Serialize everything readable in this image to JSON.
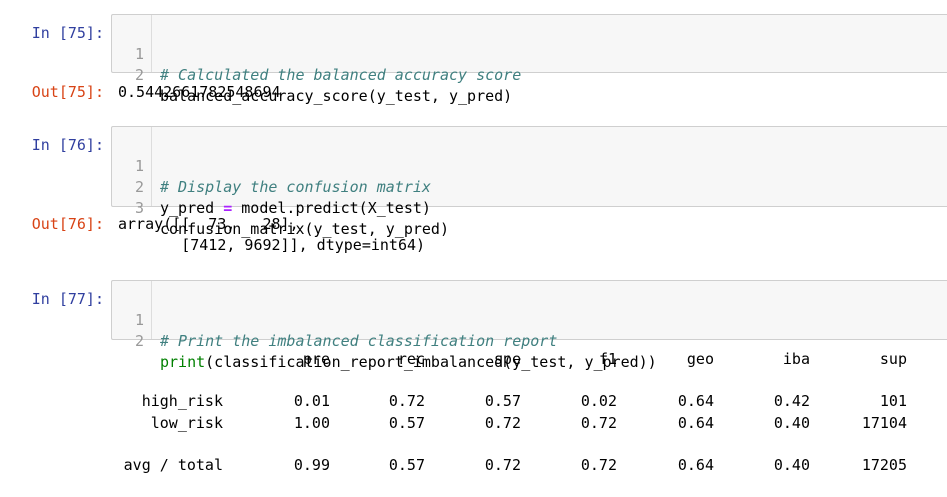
{
  "cells": [
    {
      "in_prompt": "In [75]:",
      "lines": [
        {
          "num": "1",
          "comment": "# Calculated the balanced accuracy score"
        },
        {
          "num": "2",
          "code": "balanced_accuracy_score(y_test, y_pred)"
        }
      ],
      "out_prompt": "Out[75]:",
      "output": "0.5442661782548694"
    },
    {
      "in_prompt": "In [76]:",
      "lines": [
        {
          "num": "1",
          "comment": "# Display the confusion matrix"
        },
        {
          "num": "2",
          "code_a": "y_pred ",
          "op": "=",
          "code_b": " model.predict(X_test)"
        },
        {
          "num": "3",
          "code": "confusion_matrix(y_test, y_pred)"
        }
      ],
      "out_prompt": "Out[76]:",
      "output_lines": [
        "array([[  73,   28],",
        "       [7412, 9692]], dtype=int64)"
      ]
    },
    {
      "in_prompt": "In [77]:",
      "lines": [
        {
          "num": "1",
          "comment": "# Print the imbalanced classification report"
        },
        {
          "num": "2",
          "builtin": "print",
          "code": "(classification_report_imbalanced(y_test, y_pred))"
        }
      ]
    }
  ],
  "report": {
    "headers": [
      "pre",
      "rec",
      "spe",
      "f1",
      "geo",
      "iba",
      "sup"
    ],
    "rows": [
      {
        "label": "high_risk",
        "values": [
          "0.01",
          "0.72",
          "0.57",
          "0.02",
          "0.64",
          "0.42",
          "101"
        ]
      },
      {
        "label": "low_risk",
        "values": [
          "1.00",
          "0.57",
          "0.72",
          "0.72",
          "0.64",
          "0.40",
          "17104"
        ]
      },
      {
        "label": "avg / total",
        "values": [
          "0.99",
          "0.57",
          "0.72",
          "0.72",
          "0.64",
          "0.40",
          "17205"
        ]
      }
    ]
  },
  "colors": {
    "in_prompt": "#303f9f",
    "out_prompt": "#d84315",
    "comment": "#408080",
    "builtin": "#008000",
    "operator": "#aa22ff",
    "input_bg": "#f7f7f7"
  }
}
